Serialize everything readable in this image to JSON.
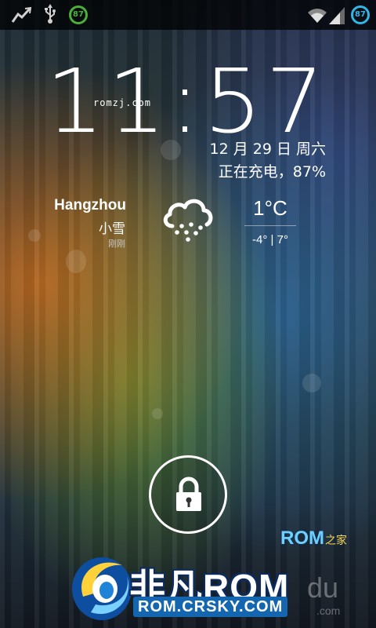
{
  "status_bar": {
    "left_battery_level": "87",
    "right_battery_level": "87",
    "icons": [
      "activity-graph-icon",
      "usb-icon",
      "battery-ring-icon",
      "wifi-icon",
      "signal-icon",
      "battery-ring-icon"
    ],
    "left_ring_color": "#4caf3a",
    "right_ring_color": "#33b5e5"
  },
  "lockscreen": {
    "time": "11:57",
    "date": "12 月 29 日 周六",
    "charging": "正在充电，87%",
    "watermark": "romzj.com"
  },
  "weather": {
    "city": "Hangzhou",
    "condition": "小雪",
    "updated": "刚刚",
    "temperature": "1°C",
    "range": "-4° | 7°",
    "icon": "snow-cloud-icon"
  },
  "unlock": {
    "icon": "lock-icon"
  },
  "branding": {
    "rom_zhijia": "ROM",
    "rom_zhijia_suffix": "之家",
    "name": "非凡ROM",
    "url": "ROM.CRSKY.COM",
    "faint_du": "du",
    "faint_com": ".com"
  }
}
